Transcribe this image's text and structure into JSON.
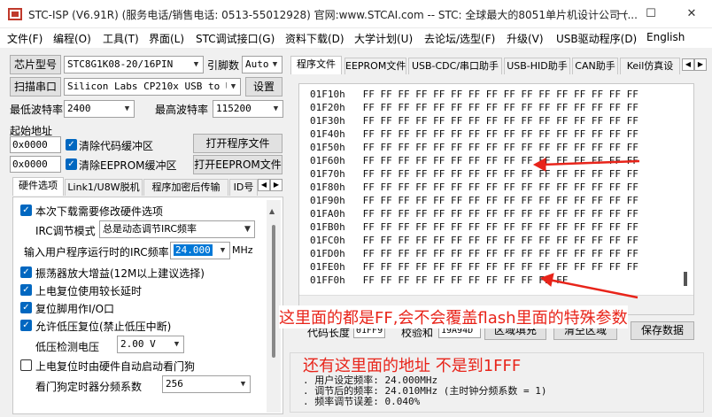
{
  "window": {
    "title": "STC-ISP (V6.91R) (服务电话/销售电话: 0513-55012928) 官网:www.STCAI.com  -- STC: 全球最大的8051单片机设计公司 (...",
    "minimize": "—",
    "maximize": "☐",
    "close": "✕"
  },
  "menu": [
    "文件(F)",
    "编程(O)",
    "工具(T)",
    "界面(L)",
    "STC调试接口(G)",
    "资料下载(D)",
    "大学计划(U)",
    "去论坛/选型(F)",
    "升级(V)",
    "USB驱动程序(D)",
    "English"
  ],
  "left": {
    "chip_label": "芯片型号",
    "chip_value": "STC8G1K08-20/16PIN",
    "pins_label": "引脚数",
    "pins_value": "Auto",
    "scan_button": "扫描串口",
    "port_value": "Silicon Labs CP210x USB to UART",
    "settings_button": "设置",
    "min_baud_label": "最低波特率",
    "min_baud_value": "2400",
    "max_baud_label": "最高波特率",
    "max_baud_value": "115200",
    "start_addr_label": "起始地址",
    "addr1": "0x0000",
    "clear_code": "清除代码缓冲区",
    "open_prog": "打开程序文件",
    "addr2": "0x0000",
    "clear_eeprom": "清除EEPROM缓冲区",
    "open_eeprom": "打开EEPROM文件",
    "tabs": [
      "硬件选项",
      "Link1/U8W脱机",
      "程序加密后传输",
      "ID号"
    ],
    "hw": {
      "opt_change_hw": "本次下载需要修改硬件选项",
      "irc_mode_label": "IRC调节模式",
      "irc_mode_value": "总是动态调节IRC频率",
      "freq_label": "输入用户程序运行时的IRC频率",
      "freq_value": "24.000",
      "freq_unit": "MHz",
      "opt_osc": "振荡器放大增益(12M以上建议选择)",
      "opt_delay": "上电复位使用较长延时",
      "opt_reset_io": "复位脚用作I/O口",
      "opt_lvr": "允许低压复位(禁止低压中断)",
      "lvd_label": "低压检测电压",
      "lvd_value": "2.00 V",
      "opt_wdt": "上电复位时由硬件自动启动看门狗",
      "wdt_label": "看门狗定时器分频系数",
      "wdt_value": "256"
    }
  },
  "right": {
    "tabs": [
      "程序文件",
      "EEPROM文件",
      "USB-CDC/串口助手",
      "USB-HID助手",
      "CAN助手",
      "Keil仿真设"
    ],
    "hex_rows": [
      {
        "addr": "01F10h",
        "data": "FF FF FF FF FF FF FF FF FF FF FF FF FF FF FF FF"
      },
      {
        "addr": "01F20h",
        "data": "FF FF FF FF FF FF FF FF FF FF FF FF FF FF FF FF"
      },
      {
        "addr": "01F30h",
        "data": "FF FF FF FF FF FF FF FF FF FF FF FF FF FF FF FF"
      },
      {
        "addr": "01F40h",
        "data": "FF FF FF FF FF FF FF FF FF FF FF FF FF FF FF FF"
      },
      {
        "addr": "01F50h",
        "data": "FF FF FF FF FF FF FF FF FF FF FF FF FF FF FF FF"
      },
      {
        "addr": "01F60h",
        "data": "FF FF FF FF FF FF FF FF FF FF FF FF FF FF FF FF"
      },
      {
        "addr": "01F70h",
        "data": "FF FF FF FF FF FF FF FF FF FF FF FF FF FF FF FF"
      },
      {
        "addr": "01F80h",
        "data": "FF FF FF FF FF FF FF FF FF FF FF FF FF FF FF FF"
      },
      {
        "addr": "01F90h",
        "data": "FF FF FF FF FF FF FF FF FF FF FF FF FF FF FF FF"
      },
      {
        "addr": "01FA0h",
        "data": "FF FF FF FF FF FF FF FF FF FF FF FF FF FF FF FF"
      },
      {
        "addr": "01FB0h",
        "data": "FF FF FF FF FF FF FF FF FF FF FF FF FF FF FF FF"
      },
      {
        "addr": "01FC0h",
        "data": "FF FF FF FF FF FF FF FF FF FF FF FF FF FF FF FF"
      },
      {
        "addr": "01FD0h",
        "data": "FF FF FF FF FF FF FF FF FF FF FF FF FF FF FF FF"
      },
      {
        "addr": "01FE0h",
        "data": "FF FF FF FF FF FF FF FF FF FF FF FF FF FF FF FF"
      },
      {
        "addr": "01FF0h",
        "data": "FF FF FF FF FF FF FF FF FF FF FF FF"
      }
    ],
    "code_len_label": "代码长度",
    "code_len_value": "01FF9",
    "checksum_label": "校验和",
    "checksum_value": "19A94D",
    "fill_button": "区域填充",
    "clear_button": "清空区域",
    "save_button": "保存数据",
    "messages": [
      ". 用户设定频率: 24.000MHz",
      ". 调节后的频率: 24.010MHz (主时钟分频系数 = 1)",
      ". 频率调节误差: 0.040%"
    ]
  },
  "annotations": {
    "note1": "这里面的都是FF,会不会覆盖flash里面的特殊参数",
    "note2": "还有这里面的地址 不是到1FFF",
    "color": "#e8241a"
  }
}
